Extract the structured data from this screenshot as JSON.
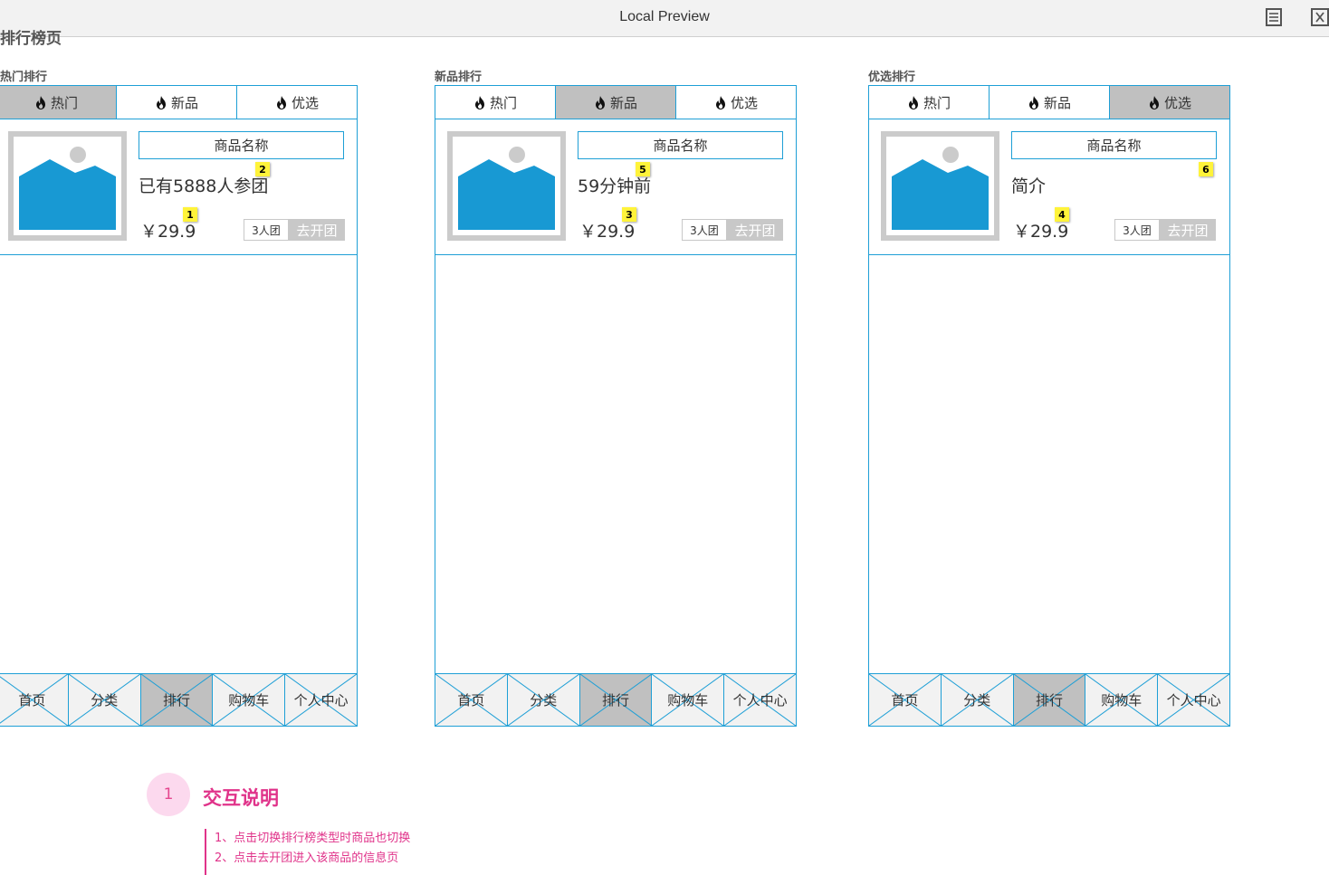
{
  "window": {
    "title": "Local Preview"
  },
  "page_title": "排行榜页",
  "panels": [
    {
      "label": "热门排行",
      "tabs": [
        "热门",
        "新品",
        "优选"
      ],
      "active_tab": 0,
      "card": {
        "name": "商品名称",
        "subtext": "已有5888人参团",
        "price": "￥29.9",
        "group_count": "3人团",
        "group_button": "去开团",
        "marker_sub": "2",
        "marker_price": "1"
      },
      "nav": [
        "首页",
        "分类",
        "排行",
        "购物车",
        "个人中心"
      ],
      "active_nav": 2
    },
    {
      "label": "新品排行",
      "tabs": [
        "热门",
        "新品",
        "优选"
      ],
      "active_tab": 1,
      "card": {
        "name": "商品名称",
        "subtext": "59分钟前",
        "price": "￥29.9",
        "group_count": "3人团",
        "group_button": "去开团",
        "marker_sub": "5",
        "marker_price": "3"
      },
      "nav": [
        "首页",
        "分类",
        "排行",
        "购物车",
        "个人中心"
      ],
      "active_nav": 2
    },
    {
      "label": "优选排行",
      "tabs": [
        "热门",
        "新品",
        "优选"
      ],
      "active_tab": 2,
      "card": {
        "name": "商品名称",
        "subtext": "简介",
        "price": "￥29.9",
        "group_count": "3人团",
        "group_button": "去开团",
        "marker_sub": "6",
        "marker_price": "4"
      },
      "nav": [
        "首页",
        "分类",
        "排行",
        "购物车",
        "个人中心"
      ],
      "active_nav": 2
    }
  ],
  "note": {
    "number": "1",
    "title": "交互说明",
    "lines": [
      "1、点击切换排行榜类型时商品也切换",
      "2、点击去开团进入该商品的信息页"
    ]
  },
  "colors": {
    "border": "#1e9fd6",
    "image_fill": "#1899d3",
    "active_tab": "#c0c0c0",
    "marker": "#fff33a",
    "note_accent": "#e0338a"
  },
  "icons": [
    "fire-icon",
    "image-placeholder-icon",
    "document-icon",
    "close-window-icon"
  ]
}
